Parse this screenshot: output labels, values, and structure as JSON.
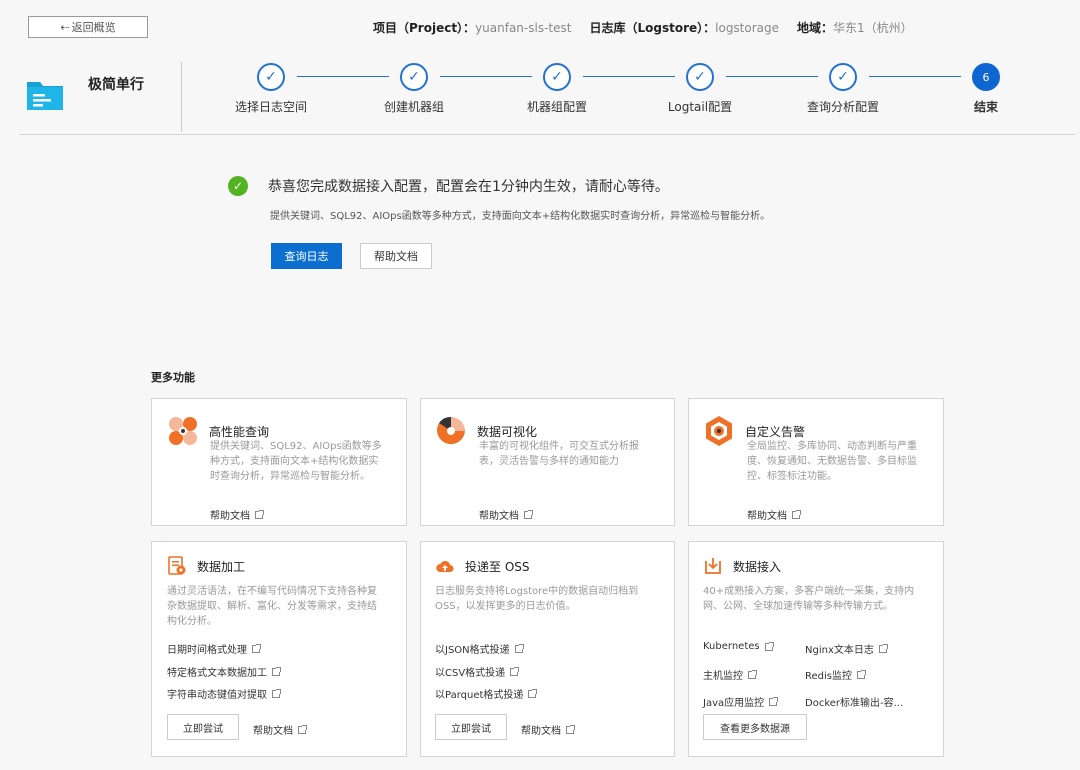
{
  "header": {
    "back_label": "返回概览",
    "project_key": "项目（Project）：",
    "project_val": "yuanfan-sls-test",
    "logstore_key": "日志库（Logstore）：",
    "logstore_val": "logstorage",
    "region_key": "地域：",
    "region_val": "华东1（杭州）"
  },
  "brand": {
    "title": "极简单行"
  },
  "steps": [
    {
      "label": "选择日志空间",
      "state": "done"
    },
    {
      "label": "创建机器组",
      "state": "done"
    },
    {
      "label": "机器组配置",
      "state": "done"
    },
    {
      "label": "Logtail配置",
      "state": "done"
    },
    {
      "label": "查询分析配置",
      "state": "done"
    },
    {
      "label": "结束",
      "state": "current",
      "number": "6"
    }
  ],
  "success": {
    "title": "恭喜您完成数据接入配置，配置会在1分钟内生效，请耐心等待。",
    "subtitle": "提供关键词、SQL92、AIOps函数等多种方式，支持面向文本+结构化数据实时查询分析，异常巡检与智能分析。",
    "primary_btn": "查询日志",
    "secondary_btn": "帮助文档"
  },
  "more": {
    "title": "更多功能",
    "cards": [
      {
        "title": "高性能查询",
        "desc": [
          "提供关键词、SQL92、AIOps函数等多",
          "种方式，支持面向文本+结构化数据实",
          "时查询分析，异常巡检与智能分析。"
        ],
        "help": "帮助文档"
      },
      {
        "title": "数据可视化",
        "desc": [
          "丰富的可视化组件，可交互式分析报",
          "表，灵活告警与多样的通知能力"
        ],
        "help": "帮助文档"
      },
      {
        "title": "自定义告警",
        "desc": [
          "全局监控、多库协同、动态判断与严重",
          "度、恢复通知、无数据告警、多目标监",
          "控、标签标注功能。"
        ],
        "help": "帮助文档"
      },
      {
        "title": "数据加工",
        "desc": [
          "通过灵活语法，在不编写代码情况下支持各种复",
          "杂数据提取、解析、富化、分发等需求，支持结",
          "构化分析。"
        ],
        "links": [
          "日期时间格式处理",
          "特定格式文本数据加工",
          "字符串动态键值对提取"
        ],
        "try": "立即尝试",
        "help": "帮助文档"
      },
      {
        "title": "投递至 OSS",
        "desc": [
          "日志服务支持将Logstore中的数据自动归档到",
          "OSS，以发挥更多的日志价值。"
        ],
        "links": [
          "以JSON格式投递",
          "以CSV格式投递",
          "以Parquet格式投递"
        ],
        "try": "立即尝试",
        "help": "帮助文档"
      },
      {
        "title": "数据接入",
        "desc": [
          "40+成熟接入方案，多客户端统一采集，支持内",
          "网、公网、全球加速传输等多种传输方式。"
        ],
        "sources": [
          "Kubernetes",
          "Nginx文本日志",
          "主机监控",
          "Redis监控",
          "Java应用监控",
          "Docker标准输出-容..."
        ],
        "more_btn": "查看更多数据源"
      }
    ]
  },
  "colors": {
    "primary": "#0c6fd0",
    "success": "#52b420",
    "accent_orange": "#f07126"
  }
}
